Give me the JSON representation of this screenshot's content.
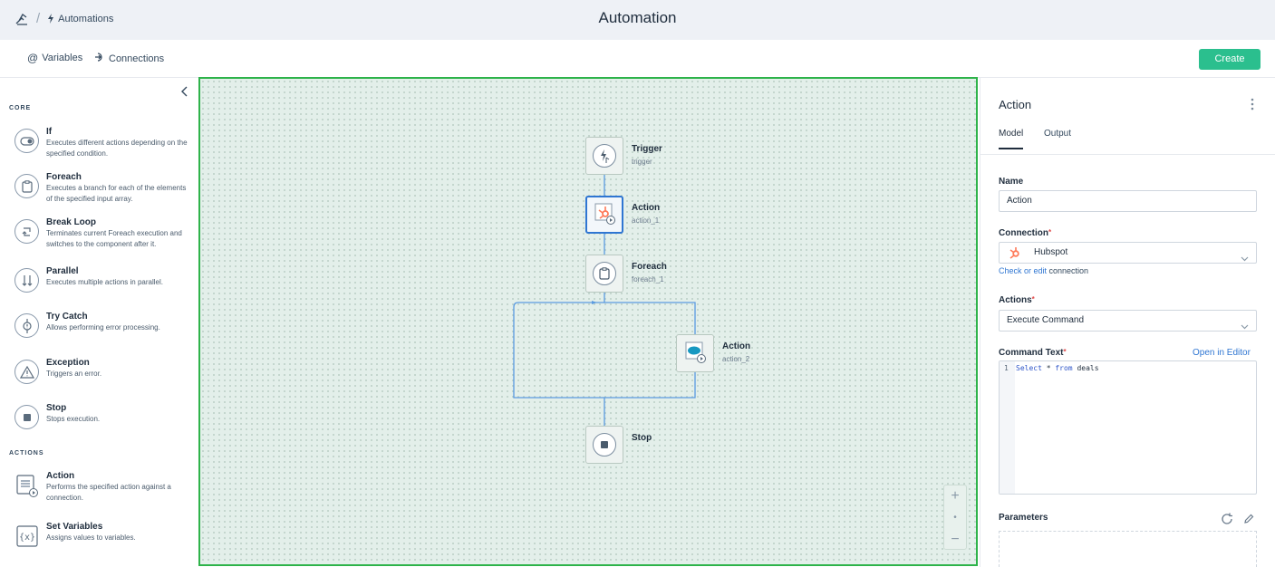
{
  "header": {
    "breadcrumb_label": "Automations",
    "title": "Automation"
  },
  "subbar": {
    "variables_label": "Variables",
    "connections_label": "Connections",
    "create_label": "Create"
  },
  "palette": {
    "core_heading": "CORE",
    "actions_heading": "ACTIONS",
    "core": [
      {
        "name": "If",
        "desc": "Executes different actions depending on the specified condition.",
        "icon": "toggle-icon"
      },
      {
        "name": "Foreach",
        "desc": "Executes a branch for each of the elements of the specified input array.",
        "icon": "clipboard-icon"
      },
      {
        "name": "Break Loop",
        "desc": "Terminates current Foreach execution and switches to the component after it.",
        "icon": "break-loop-icon"
      },
      {
        "name": "Parallel",
        "desc": "Executes multiple actions in parallel.",
        "icon": "parallel-icon"
      },
      {
        "name": "Try Catch",
        "desc": "Allows performing error processing.",
        "icon": "try-catch-icon"
      },
      {
        "name": "Exception",
        "desc": "Triggers an error.",
        "icon": "warning-icon"
      },
      {
        "name": "Stop",
        "desc": "Stops execution.",
        "icon": "stop-icon"
      }
    ],
    "actions": [
      {
        "name": "Action",
        "desc": "Performs the specified action against a connection.",
        "icon": "action-icon"
      },
      {
        "name": "Set Variables",
        "desc": "Assigns values to variables.",
        "icon": "variables-icon"
      }
    ]
  },
  "flow": {
    "nodes": [
      {
        "label": "Trigger",
        "sub": "trigger",
        "icon": "lightning-click-icon"
      },
      {
        "label": "Action",
        "sub": "action_1",
        "icon": "hubspot-icon",
        "selected": true
      },
      {
        "label": "Foreach",
        "sub": "foreach_1",
        "icon": "clipboard-icon"
      },
      {
        "label": "Action",
        "sub": "action_2",
        "icon": "salesforce-icon"
      },
      {
        "label": "Stop",
        "sub": "",
        "icon": "stop-icon"
      }
    ],
    "zoom": {
      "plus": "+",
      "reset": "•",
      "minus": "−"
    }
  },
  "inspector": {
    "title": "Action",
    "tabs": [
      "Model",
      "Output"
    ],
    "active_tab": "Model",
    "name_label": "Name",
    "name_value": "Action",
    "connection_label": "Connection",
    "connection_value": "Hubspot",
    "connection_hint_link": "Check or edit",
    "connection_hint_rest": " connection",
    "actions_label": "Actions",
    "actions_value": "Execute Command",
    "command_label": "Command Text",
    "open_editor_label": "Open in Editor",
    "code_line_number": "1",
    "code_keyword_select": "Select",
    "code_star": " * ",
    "code_keyword_from": "from",
    "code_table": " deals",
    "parameters_label": "Parameters"
  },
  "colors": {
    "accent": "#2bbf8e",
    "canvas_border": "#2eb34a",
    "selected_border": "#2f76d2",
    "hubspot": "#ff7a59",
    "salesforce": "#1798c1"
  }
}
